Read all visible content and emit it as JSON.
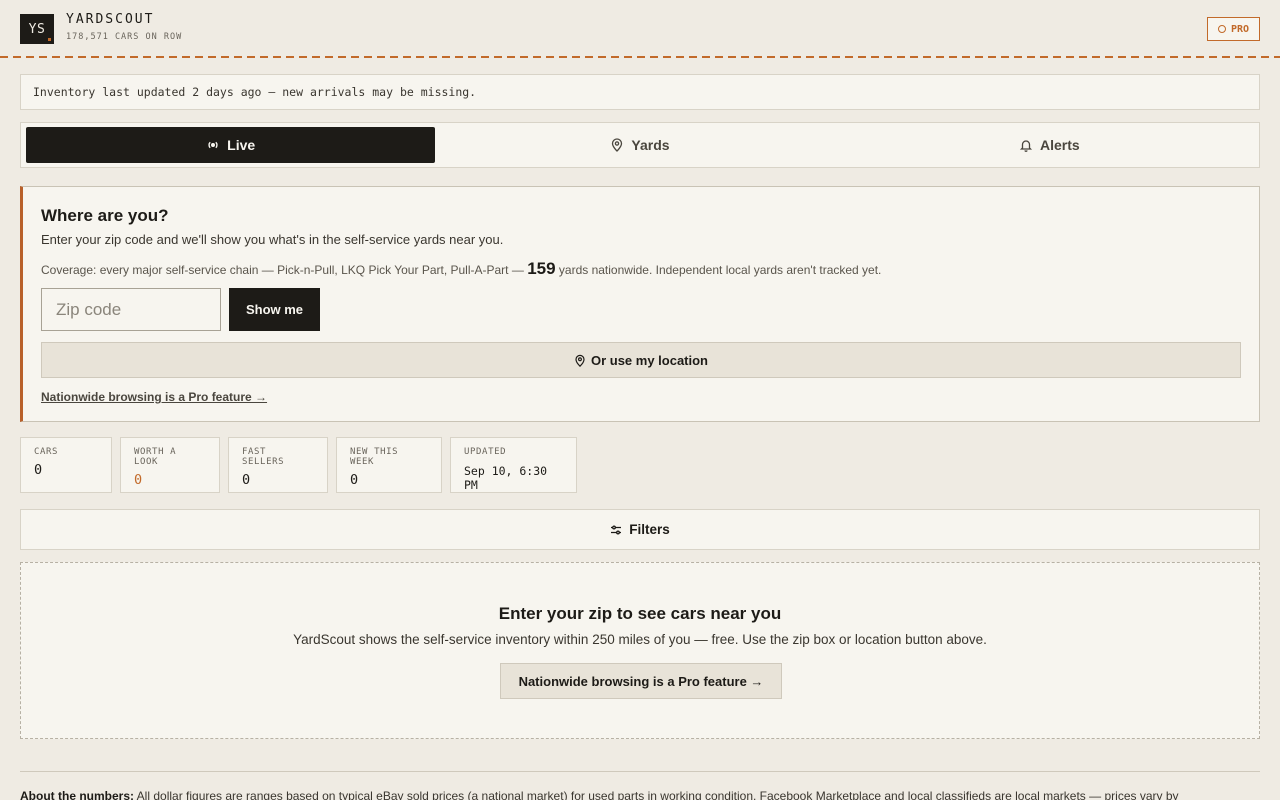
{
  "header": {
    "logo_text": "YS",
    "brand_name": "YARDSCOUT",
    "brand_sub": "178,571 CARS ON ROW",
    "pro_label": "PRO"
  },
  "notice": "Inventory last updated 2 days ago — new arrivals may be missing.",
  "tabs": [
    {
      "label": "Live",
      "icon": "radio-live-icon",
      "active": true
    },
    {
      "label": "Yards",
      "icon": "map-pin-icon",
      "active": false
    },
    {
      "label": "Alerts",
      "icon": "bell-icon",
      "active": false
    }
  ],
  "location": {
    "title": "Where are you?",
    "description": "Enter your zip code and we'll show you what's in the self-service yards near you.",
    "coverage_prefix": "Coverage: every major self-service chain — Pick-n-Pull, LKQ Pick Your Part, Pull-A-Part —",
    "coverage_count": "159",
    "coverage_suffix": "yards nationwide. Independent local yards aren't tracked yet.",
    "zip_placeholder": "Zip code",
    "zip_value": "",
    "show_button": "Show me",
    "locate_button": "Or use my location",
    "pro_link": "Nationwide browsing is a Pro feature →"
  },
  "stats": [
    {
      "label": "CARS",
      "value": "0"
    },
    {
      "label": "WORTH A LOOK",
      "value": "0"
    },
    {
      "label": "FAST SELLERS",
      "value": "0"
    },
    {
      "label": "NEW THIS WEEK",
      "value": "0"
    },
    {
      "label": "UPDATED",
      "value": "Sep 10, 6:30 PM"
    }
  ],
  "filters_label": "Filters",
  "empty": {
    "title": "Enter your zip to see cars near you",
    "description": "YardScout shows the self-service inventory within 250 miles of you — free. Use the zip box or location button above.",
    "button": "Nationwide browsing is a Pro feature →"
  },
  "footer": {
    "lead": "About the numbers:",
    "text": "All dollar figures are ranges based on typical eBay sold prices (a national market) for used parts in working condition. Facebook Marketplace and local classifieds are local markets — prices vary by"
  },
  "colors": {
    "accent": "#c26a2a",
    "ink": "#1d1b17",
    "paper": "#f7f5ef",
    "background": "#efebe3"
  }
}
